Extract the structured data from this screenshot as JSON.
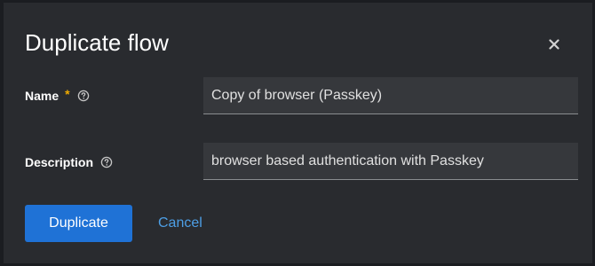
{
  "dialog": {
    "title": "Duplicate flow",
    "close_icon": "close-icon"
  },
  "form": {
    "name": {
      "label": "Name",
      "required_mark": "*",
      "help_icon": "help-circle-icon",
      "value": "Copy of browser (Passkey)"
    },
    "description": {
      "label": "Description",
      "help_icon": "help-circle-icon",
      "value": "browser based authentication with Passkey"
    }
  },
  "actions": {
    "primary_label": "Duplicate",
    "cancel_label": "Cancel"
  },
  "colors": {
    "background": "#292b2f",
    "primary": "#1f72d6",
    "link": "#4d9fe6",
    "required": "#f0ab00"
  }
}
